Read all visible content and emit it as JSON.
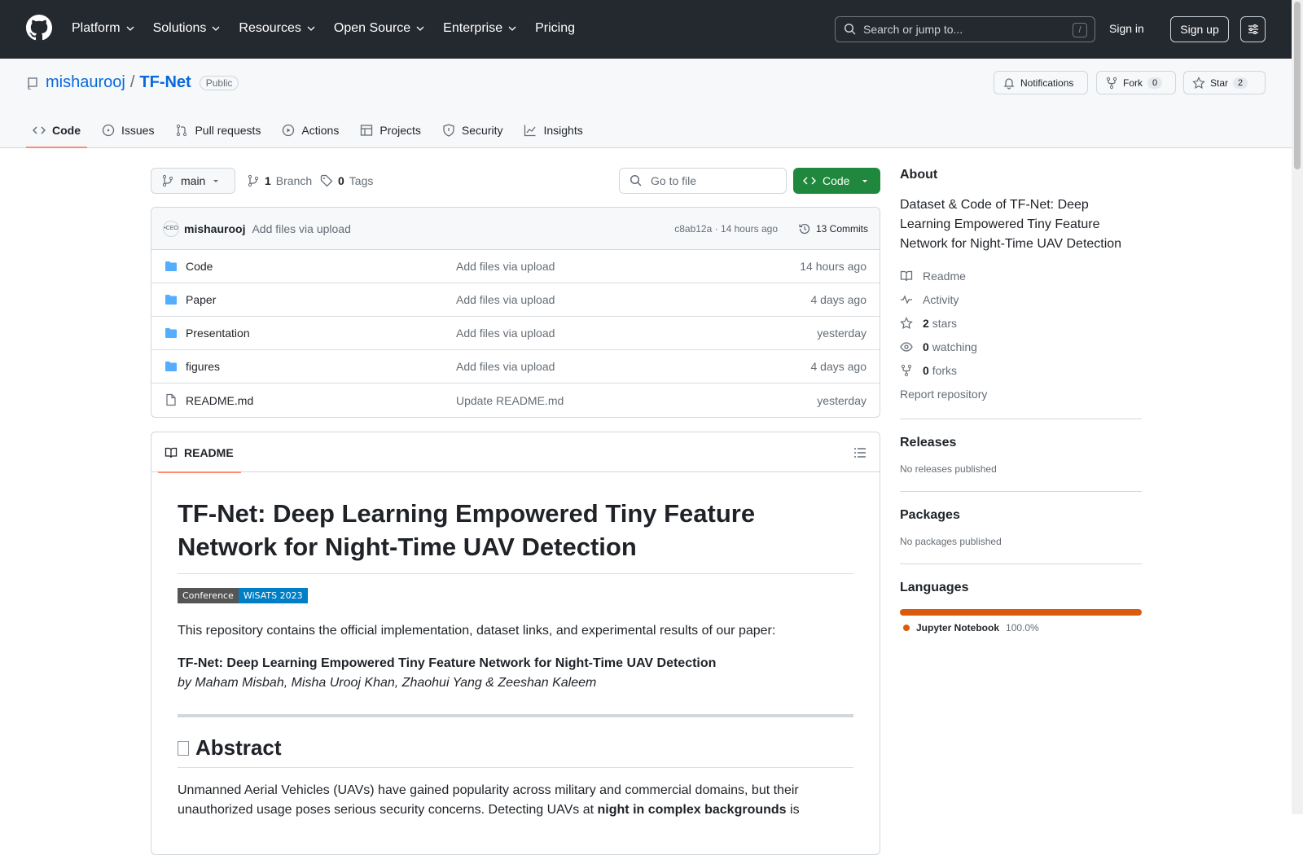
{
  "header": {
    "nav": [
      "Platform",
      "Solutions",
      "Resources",
      "Open Source",
      "Enterprise",
      "Pricing"
    ],
    "search_placeholder": "Search or jump to...",
    "search_key": "/",
    "signin": "Sign in",
    "signup": "Sign up"
  },
  "repo": {
    "owner": "mishaurooj",
    "slash": "/",
    "name": "TF-Net",
    "visibility": "Public",
    "notifications": "Notifications",
    "fork": "Fork",
    "fork_count": "0",
    "star": "Star",
    "star_count": "2"
  },
  "tabs": [
    "Code",
    "Issues",
    "Pull requests",
    "Actions",
    "Projects",
    "Security",
    "Insights"
  ],
  "toolbar": {
    "branch": "main",
    "branches_n": "1",
    "branches": "Branch",
    "tags_n": "0",
    "tags": "Tags",
    "goto": "Go to file",
    "code": "Code"
  },
  "commit": {
    "avatar": "•CEO",
    "author": "mishaurooj",
    "message": "Add files via upload",
    "hash": "c8ab12a · 14 hours ago",
    "commits": "13 Commits"
  },
  "files": [
    {
      "name": "Code",
      "type": "folder",
      "msg": "Add files via upload",
      "time": "14 hours ago"
    },
    {
      "name": "Paper",
      "type": "folder",
      "msg": "Add files via upload",
      "time": "4 days ago"
    },
    {
      "name": "Presentation",
      "type": "folder",
      "msg": "Add files via upload",
      "time": "yesterday"
    },
    {
      "name": "figures",
      "type": "folder",
      "msg": "Add files via upload",
      "time": "4 days ago"
    },
    {
      "name": "README.md",
      "type": "file",
      "msg": "Update README.md",
      "time": "yesterday"
    }
  ],
  "readme": {
    "tab": "README",
    "title": "TF-Net: Deep Learning Empowered Tiny Feature Network for Night-Time UAV Detection",
    "badge_left": "Conference",
    "badge_right": "WiSATS 2023",
    "intro": "This repository contains the official implementation, dataset links, and experimental results of our paper:",
    "paper": "TF-Net: Deep Learning Empowered Tiny Feature Network for Night-Time UAV Detection",
    "authors": "by Maham Misbah, Misha Urooj Khan, Zhaohui Yang & Zeeshan Kaleem",
    "abstract_h": "Abstract",
    "abstract_1": "Unmanned Aerial Vehicles (UAVs) have gained popularity across military and commercial domains, but their unauthorized usage poses serious security concerns. Detecting UAVs at ",
    "abstract_b": "night in complex backgrounds",
    "abstract_2": " is"
  },
  "about": {
    "title": "About",
    "desc": "Dataset & Code of TF-Net: Deep Learning Empowered Tiny Feature Network for Night-Time UAV Detection",
    "readme": "Readme",
    "activity": "Activity",
    "stars_n": "2",
    "stars": "stars",
    "watch_n": "0",
    "watch": "watching",
    "forks_n": "0",
    "forks": "forks",
    "report": "Report repository"
  },
  "releases": {
    "title": "Releases",
    "text": "No releases published"
  },
  "packages": {
    "title": "Packages",
    "text": "No packages published"
  },
  "languages": {
    "title": "Languages",
    "name": "Jupyter Notebook",
    "pct": "100.0%",
    "color": "#da5b0b"
  }
}
